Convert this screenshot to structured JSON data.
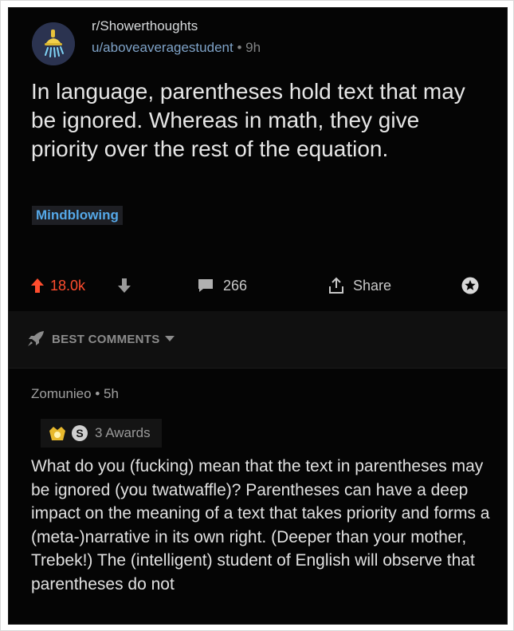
{
  "post": {
    "subreddit": "r/Showerthoughts",
    "author": "u/aboveaveragestudent",
    "separator": "•",
    "age": "9h",
    "title": "In language, parentheses hold text that may be ignored. Whereas in math, they give priority over the rest of the equation.",
    "flair": "Mindblowing",
    "upvotes": "18.0k",
    "comment_count": "266",
    "share_label": "Share"
  },
  "sort": {
    "label": "BEST COMMENTS"
  },
  "comment": {
    "author": "Zomunieo",
    "separator": "•",
    "age": "5h",
    "awards_label": "3 Awards",
    "body": "What do you (fucking) mean that the text in parentheses may be ignored (you twatwaffle)? Parentheses can have a deep impact on the meaning of a text that takes priority and forms a (meta-)narrative in its own right. (Deeper than your mother, Trebek!) The (intelligent) student of English will observe that parentheses do not"
  },
  "colors": {
    "background": "#050505",
    "upvote": "#ff4d2e",
    "flair": "#55a8e8",
    "username": "#7fa3c8"
  },
  "icons": [
    "shower-head-icon",
    "upvote-arrow-icon",
    "downvote-arrow-icon",
    "comment-bubble-icon",
    "share-icon",
    "award-icon",
    "rocket-icon",
    "caret-down-icon",
    "gold-award-icon",
    "silver-award-icon"
  ]
}
